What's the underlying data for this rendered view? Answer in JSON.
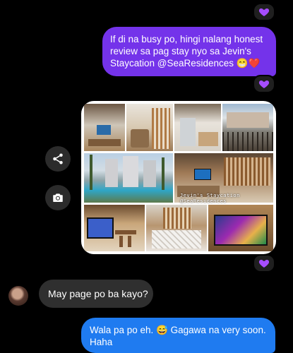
{
  "messages": {
    "sent_1": "If di na busy po, hingi nalang honest review sa pag stay nyo sa Jevin's Staycation @SeaResidences 😁❤️",
    "received_1": "May page po ba kayo?",
    "sent_2": "Wala pa po eh. 😅 Gagawa na very soon. Haha"
  },
  "photo_collage": {
    "watermark": "Jevin's Staycation @SeaResidences"
  },
  "reaction": {
    "icon": "purple-heart-icon",
    "color": "#a64dff"
  },
  "side_actions": {
    "share_icon": "share-icon",
    "camera_icon": "camera-icon"
  },
  "colors": {
    "sent_bubble": "#7433ea",
    "sent_bubble_alt": "#1f7bf0",
    "received_bubble": "#2f2f2f"
  }
}
